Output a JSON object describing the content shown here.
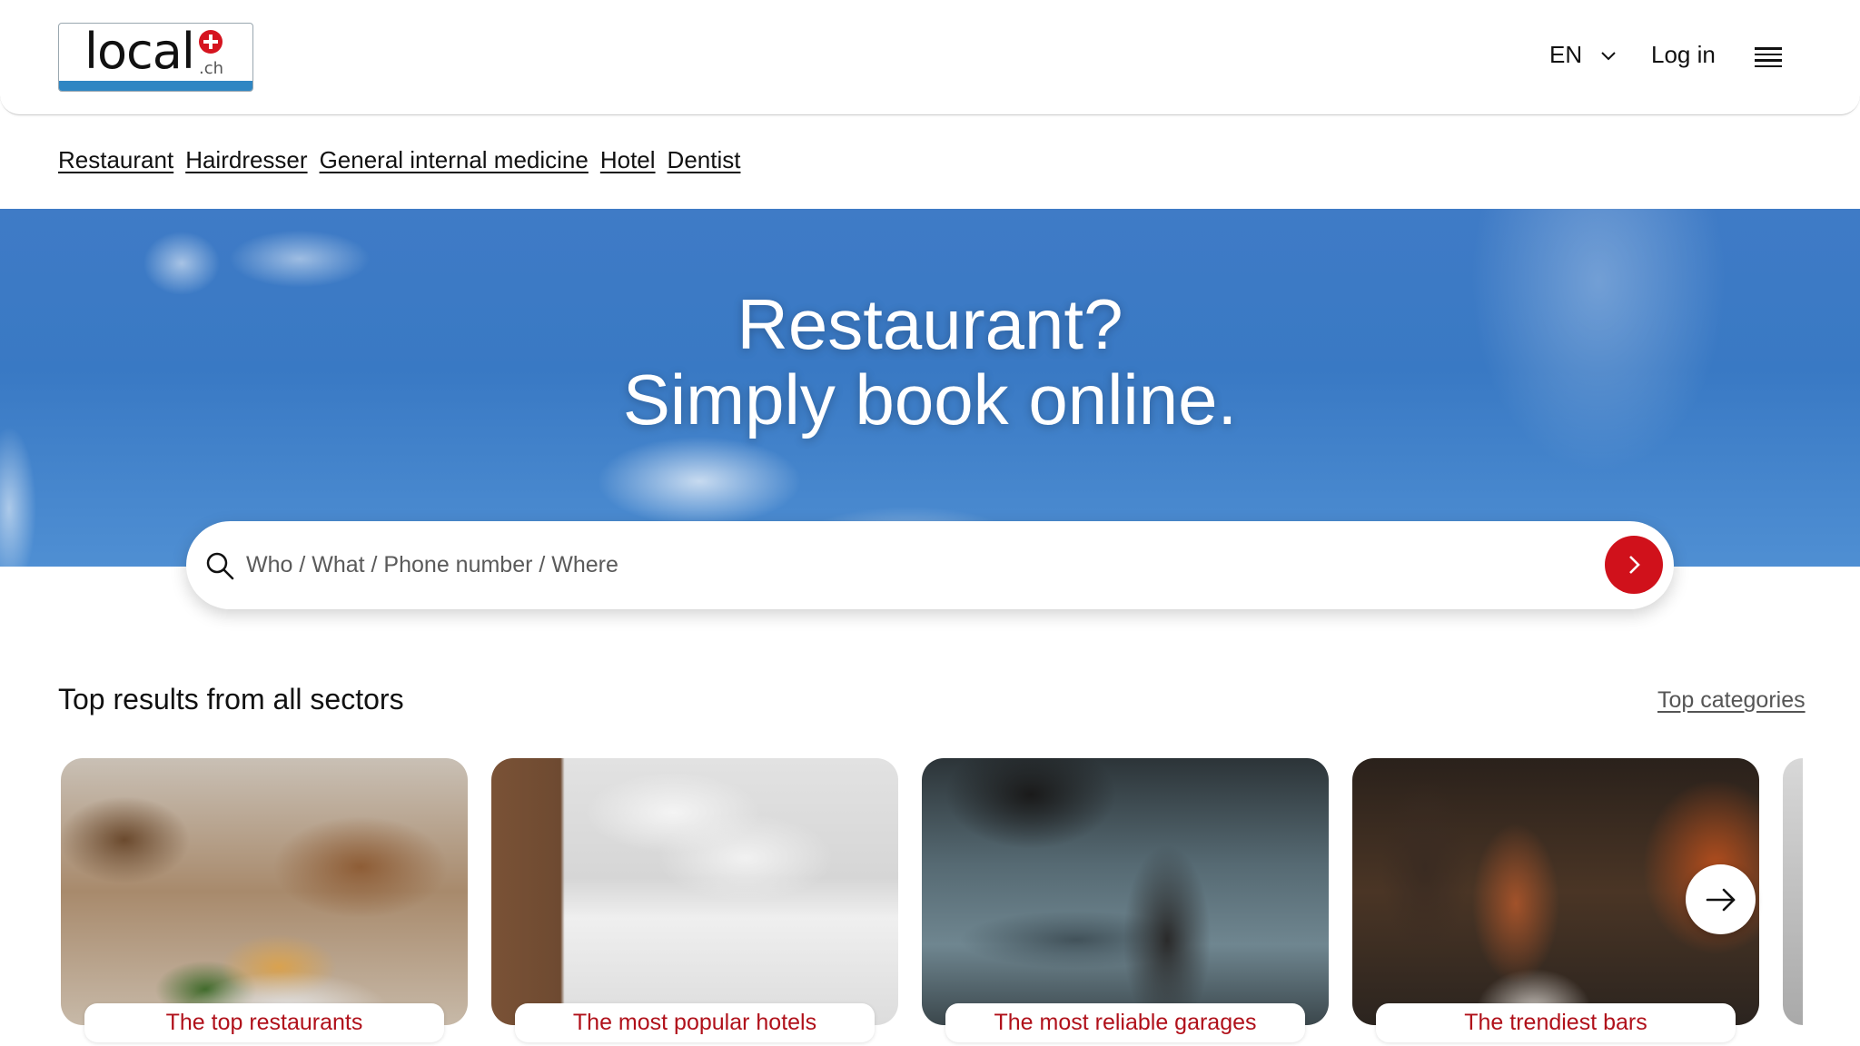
{
  "header": {
    "logo": {
      "text": "local",
      "suffix": ".ch"
    },
    "language": "EN",
    "login_label": "Log in",
    "icons": {
      "language_chevron": "chevron-down-icon",
      "menu": "hamburger-menu-icon"
    }
  },
  "quick_links": [
    "Restaurant",
    "Hairdresser",
    "General internal medicine",
    "Hotel",
    "Dentist"
  ],
  "hero": {
    "line1": "Restaurant?",
    "line2": "Simply book online."
  },
  "search": {
    "placeholder": "Who / What / Phone number / Where",
    "value": "",
    "icons": {
      "search": "search-icon",
      "submit": "chevron-right-icon"
    }
  },
  "section": {
    "title": "Top results from all sectors",
    "link": "Top categories"
  },
  "cards": [
    {
      "label": "The top restaurants"
    },
    {
      "label": "The most popular hotels"
    },
    {
      "label": "The most reliable garages"
    },
    {
      "label": "The trendiest bars"
    }
  ],
  "carousel": {
    "next_icon": "arrow-right-icon"
  },
  "colors": {
    "brand_red": "#d0111b",
    "card_label_text": "#b0101a",
    "logo_blue": "#2f86c3",
    "hero_sky": "#3979c4"
  }
}
